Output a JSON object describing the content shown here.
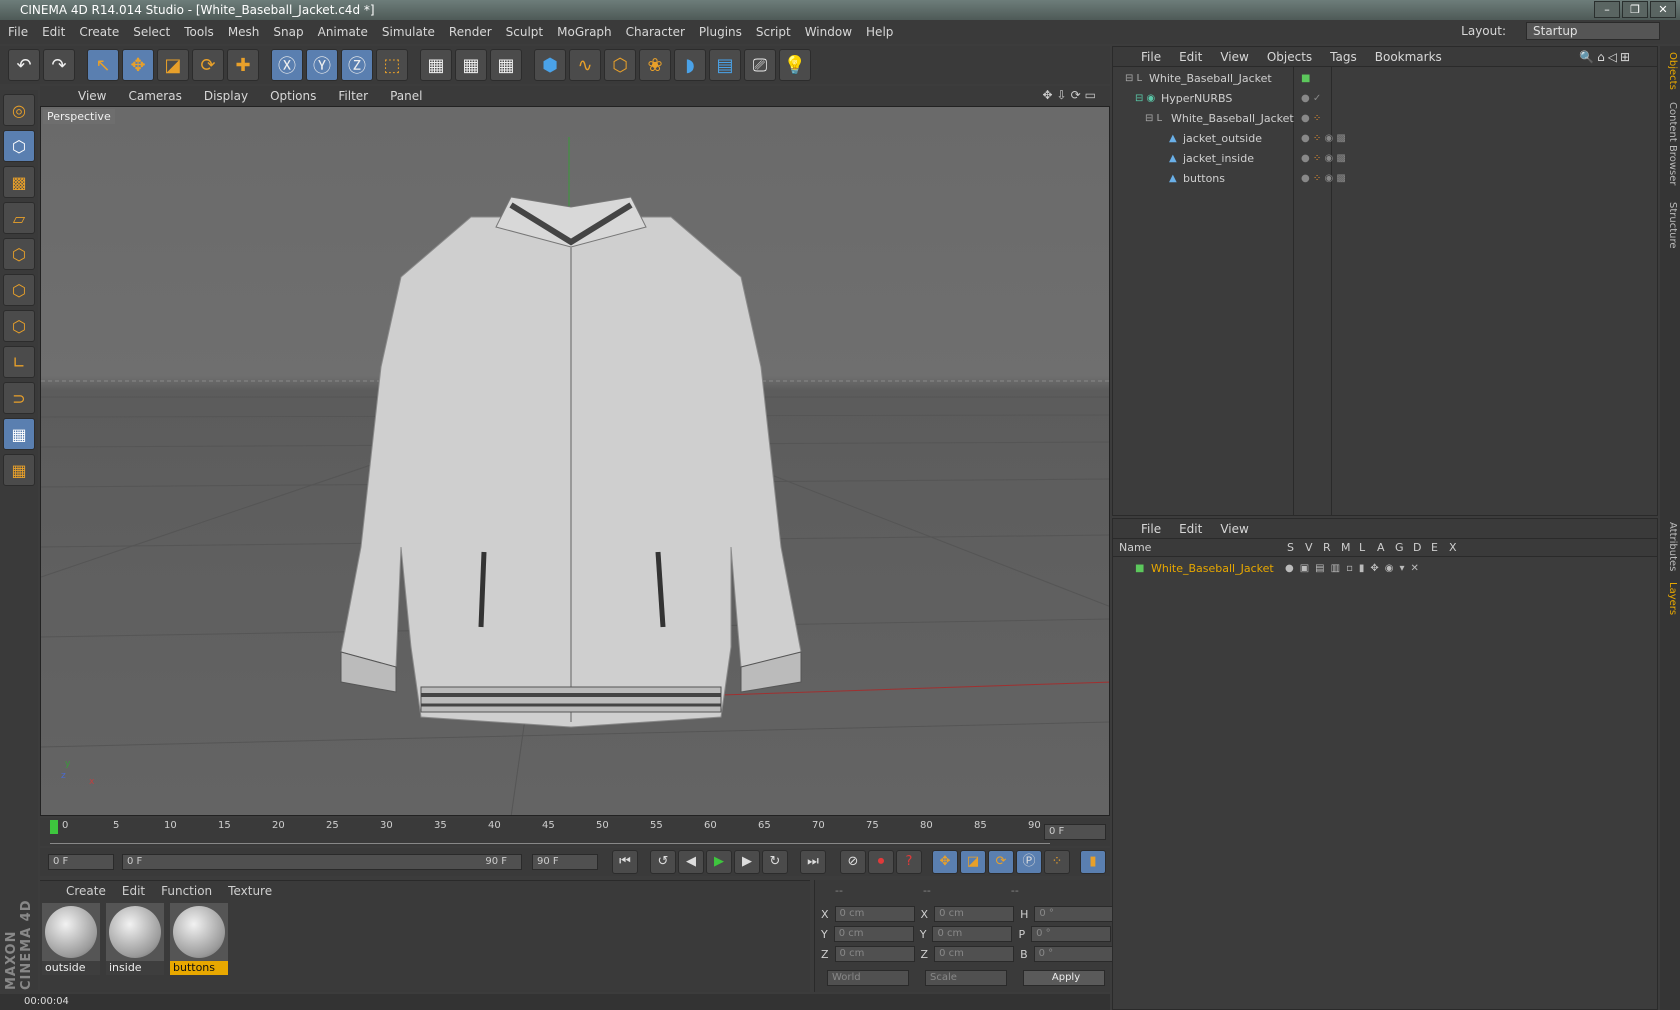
{
  "window": {
    "title": "CINEMA 4D R14.014 Studio - [White_Baseball_Jacket.c4d *]"
  },
  "menubar": {
    "items": [
      "File",
      "Edit",
      "Create",
      "Select",
      "Tools",
      "Mesh",
      "Snap",
      "Animate",
      "Simulate",
      "Render",
      "Sculpt",
      "MoGraph",
      "Character",
      "Plugins",
      "Script",
      "Window",
      "Help"
    ],
    "layout_label": "Layout:",
    "layout_value": "Startup"
  },
  "viewport": {
    "menu": [
      "View",
      "Cameras",
      "Display",
      "Options",
      "Filter",
      "Panel"
    ],
    "label": "Perspective",
    "axis_y": "y",
    "axis_x": "x",
    "axis_z": "z"
  },
  "timeline": {
    "ticks": [
      "0",
      "5",
      "10",
      "15",
      "20",
      "25",
      "30",
      "35",
      "40",
      "45",
      "50",
      "55",
      "60",
      "65",
      "70",
      "75",
      "80",
      "85",
      "90"
    ],
    "current_frame": "0 F"
  },
  "transport": {
    "start": "0 F",
    "range_start": "0 F",
    "range_end": "90 F",
    "end": "90 F"
  },
  "materials": {
    "menu": [
      "Create",
      "Edit",
      "Function",
      "Texture"
    ],
    "items": [
      "outside",
      "inside",
      "buttons"
    ],
    "selected": "buttons"
  },
  "coords": {
    "header": [
      "--",
      "--",
      "--"
    ],
    "x": "0 cm",
    "y": "0 cm",
    "z": "0 cm",
    "sx": "0 cm",
    "sy": "0 cm",
    "sz": "0 cm",
    "h": "0 °",
    "p": "0 °",
    "b": "0 °",
    "labels": [
      "X",
      "Y",
      "Z",
      "X",
      "Y",
      "Z",
      "H",
      "P",
      "B"
    ],
    "world": "World",
    "scale": "Scale",
    "apply": "Apply"
  },
  "status": {
    "text": "00:00:04"
  },
  "objects": {
    "menu": [
      "File",
      "Edit",
      "View",
      "Objects",
      "Tags",
      "Bookmarks"
    ],
    "rows": [
      "White_Baseball_Jacket",
      "HyperNURBS",
      "White_Baseball_Jacket",
      "jacket_outside",
      "jacket_inside",
      "buttons"
    ]
  },
  "layers": {
    "menu": [
      "File",
      "Edit",
      "View"
    ],
    "cols": [
      "Name",
      "S",
      "V",
      "R",
      "M",
      "L",
      "A",
      "G",
      "D",
      "E",
      "X"
    ],
    "row": "White_Baseball_Jacket"
  },
  "right_tabs": [
    "Objects",
    "Content Browser",
    "Structure",
    "Attributes",
    "Layers"
  ],
  "brand": "MAXON CINEMA 4D"
}
